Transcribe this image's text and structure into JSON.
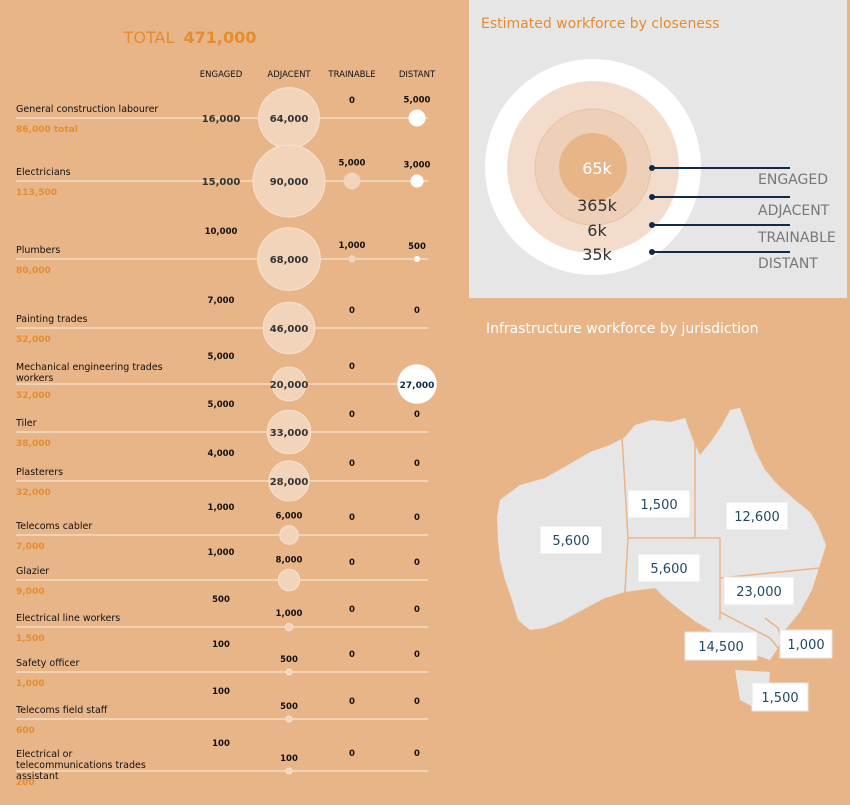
{
  "left_panel": {
    "total_prefix": "TOTAL",
    "total_value": "471,000",
    "columns": [
      "ENGAGED",
      "ADJACENT",
      "TRAINABLE",
      "DISTANT"
    ]
  },
  "right_top": {
    "title": "Estimated workforce by closeness"
  },
  "right_bottom": {
    "title": "Infrastructure workforce by jurisdiction"
  },
  "colors": {
    "background": "#e8b589",
    "panel": "#e6e6e6",
    "accent_text": "#e58d2e",
    "bubble_light": "#f2d4bb",
    "line_dark": "#0f2b45"
  },
  "chart_data": [
    {
      "type": "bubble-table",
      "title": "TOTAL 471,000",
      "columns": [
        "ENGAGED",
        "ADJACENT",
        "TRAINABLE",
        "DISTANT"
      ],
      "rows": [
        {
          "occupation": "General construction labourer",
          "total": "86,000 total",
          "values": [
            16000,
            64000,
            0,
            5000
          ]
        },
        {
          "occupation": "Electricians",
          "total": "113,500",
          "values": [
            15000,
            90000,
            5000,
            3000
          ]
        },
        {
          "occupation": "Plumbers",
          "total": "80,000",
          "values": [
            10000,
            68000,
            1000,
            500
          ]
        },
        {
          "occupation": "Painting trades",
          "total": "52,000",
          "values": [
            7000,
            46000,
            0,
            0
          ]
        },
        {
          "occupation": "Mechanical engineering trades workers",
          "total": "52,000",
          "values": [
            5000,
            20000,
            0,
            27000
          ]
        },
        {
          "occupation": "Tiler",
          "total": "38,000",
          "values": [
            5000,
            33000,
            0,
            0
          ]
        },
        {
          "occupation": "Plasterers",
          "total": "32,000",
          "values": [
            4000,
            28000,
            0,
            0
          ]
        },
        {
          "occupation": "Telecoms cabler",
          "total": "7,000",
          "values": [
            1000,
            6000,
            0,
            0
          ]
        },
        {
          "occupation": "Glazier",
          "total": "9,000",
          "values": [
            1000,
            8000,
            0,
            0
          ]
        },
        {
          "occupation": "Electrical line workers",
          "total": "1,500",
          "values": [
            500,
            1000,
            0,
            0
          ]
        },
        {
          "occupation": "Safety officer",
          "total": "1,000",
          "values": [
            100,
            500,
            0,
            0
          ]
        },
        {
          "occupation": "Telecoms field staff",
          "total": "600",
          "values": [
            100,
            500,
            0,
            0
          ]
        },
        {
          "occupation": "Electrical or telecommunications trades assistant",
          "total": "200",
          "values": [
            100,
            100,
            0,
            0
          ]
        }
      ]
    },
    {
      "type": "nested-circles",
      "title": "Estimated workforce by closeness",
      "series": [
        {
          "name": "ENGAGED",
          "label": "65k",
          "value": 65000
        },
        {
          "name": "ADJACENT",
          "label": "365k",
          "value": 365000
        },
        {
          "name": "TRAINABLE",
          "label": "6k",
          "value": 6000
        },
        {
          "name": "DISTANT",
          "label": "35k",
          "value": 35000
        }
      ]
    },
    {
      "type": "map",
      "title": "Infrastructure workforce by jurisdiction",
      "regions": [
        {
          "region": "WA",
          "value": 5600,
          "label": "5,600"
        },
        {
          "region": "NT",
          "value": 1500,
          "label": "1,500"
        },
        {
          "region": "SA",
          "value": 5600,
          "label": "5,600"
        },
        {
          "region": "QLD",
          "value": 12600,
          "label": "12,600"
        },
        {
          "region": "NSW",
          "value": 23000,
          "label": "23,000"
        },
        {
          "region": "ACT",
          "value": 1000,
          "label": "1,000"
        },
        {
          "region": "VIC",
          "value": 14500,
          "label": "14,500"
        },
        {
          "region": "TAS",
          "value": 1500,
          "label": "1,500"
        }
      ]
    }
  ]
}
